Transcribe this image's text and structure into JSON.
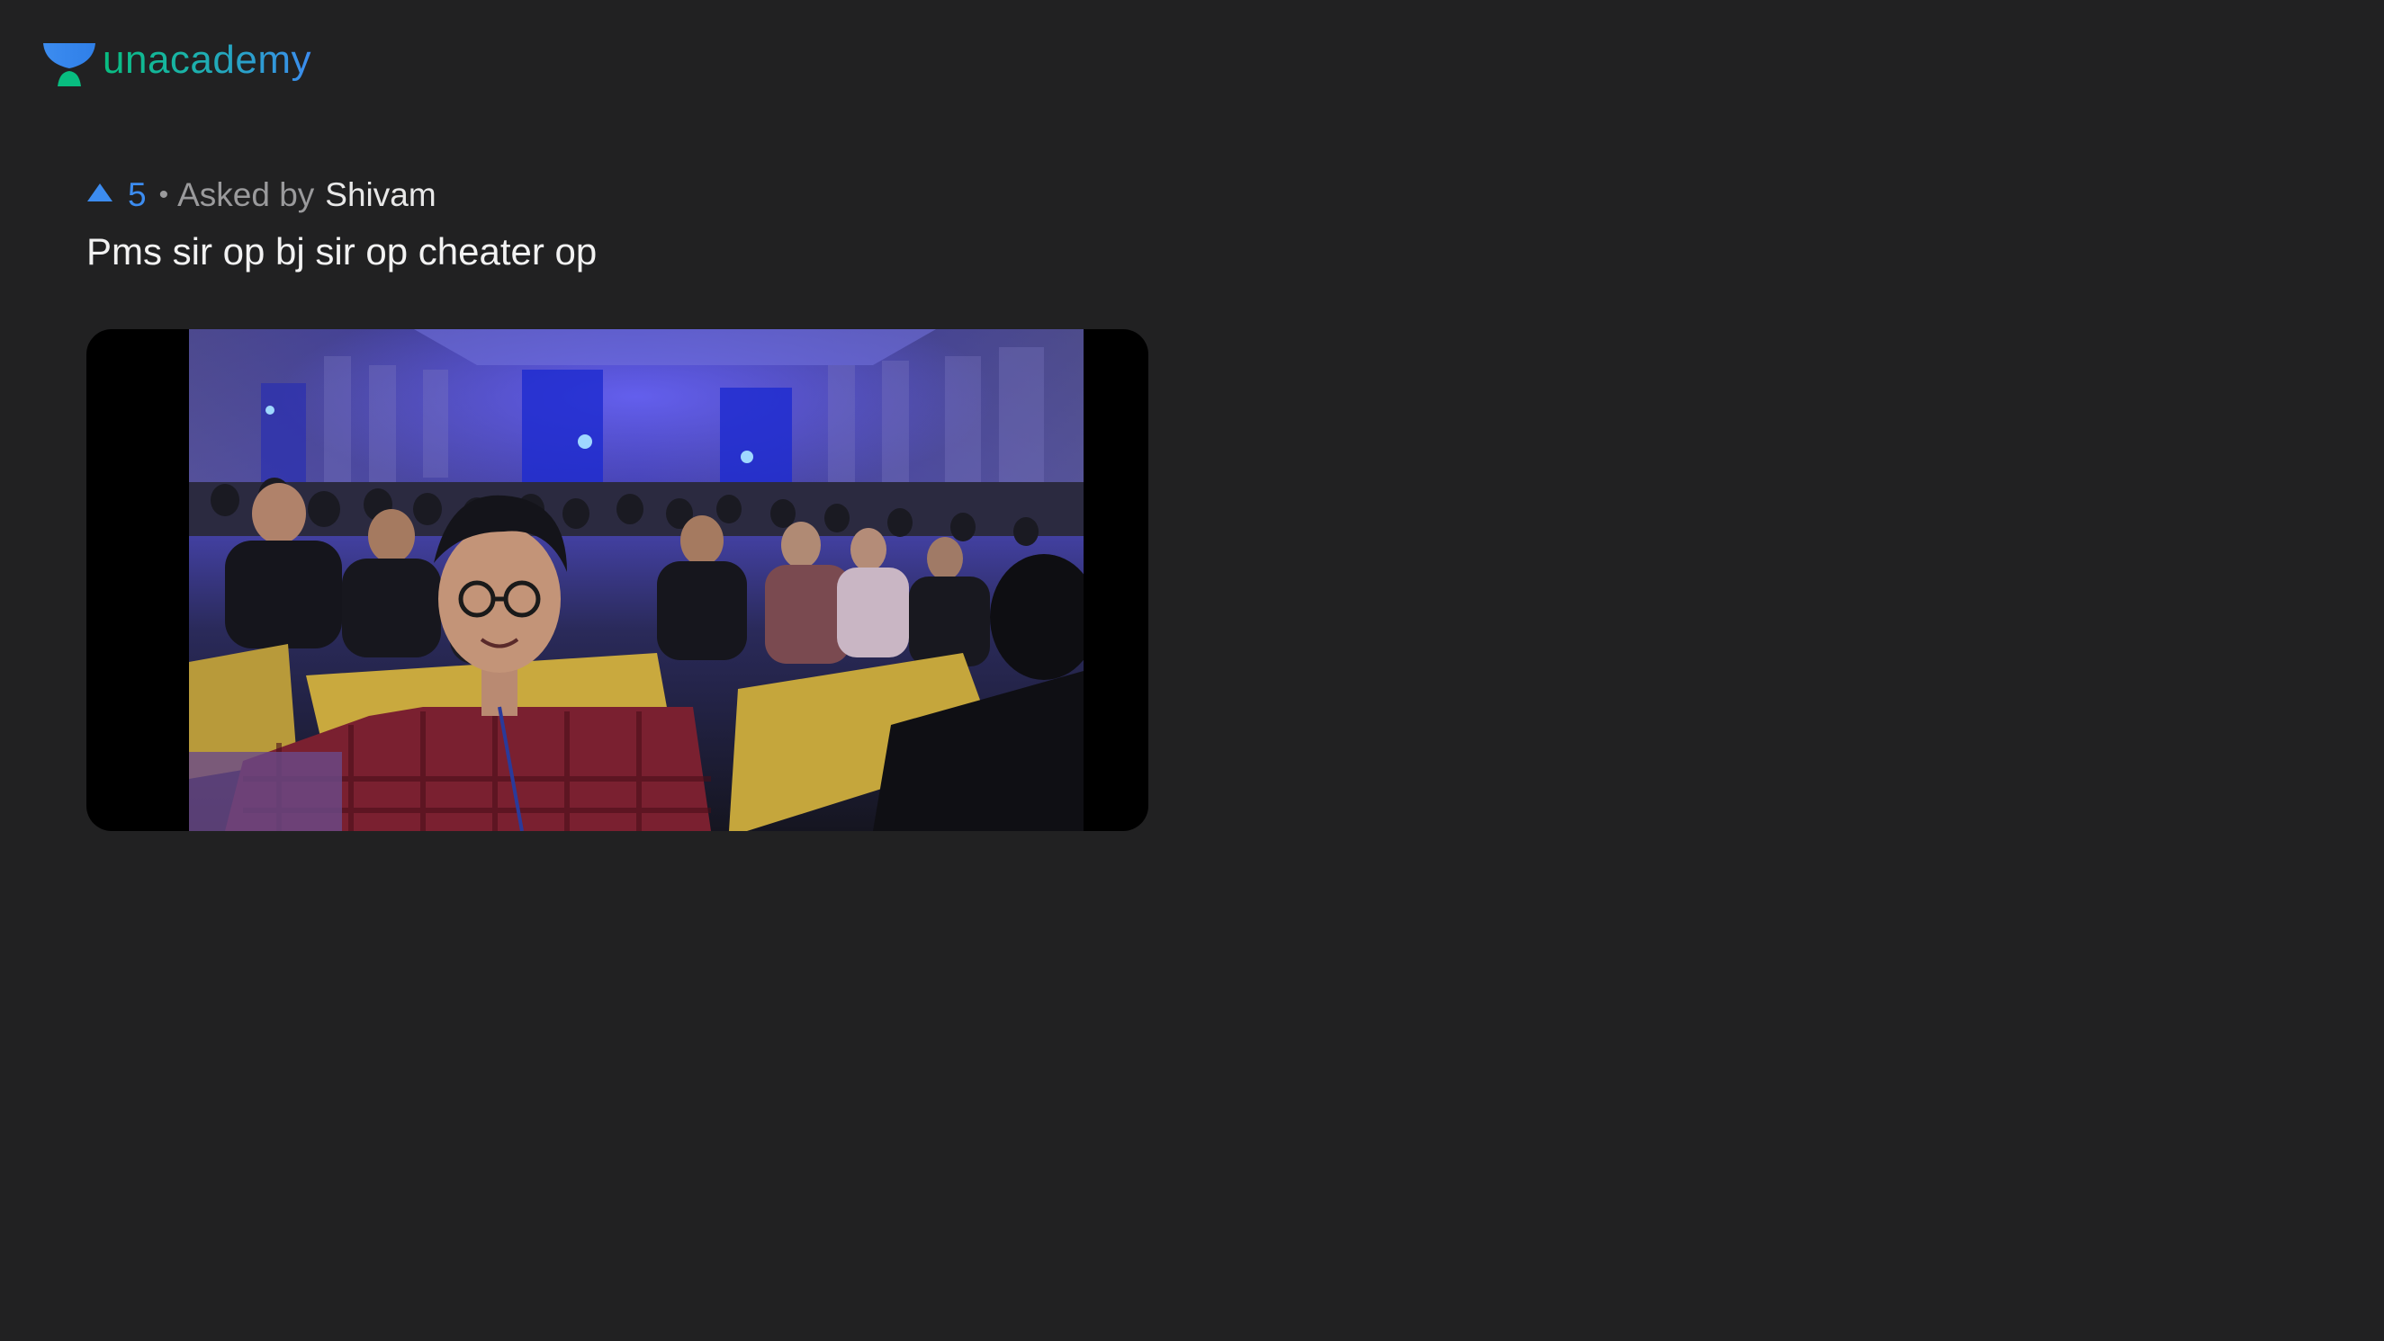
{
  "brand": {
    "name": "unacademy",
    "logo_icon": "unacademy-logo-icon",
    "colors": {
      "green": "#08bd80",
      "blue": "#3c8cf0"
    }
  },
  "question": {
    "upvote_icon": "upvote-triangle-icon",
    "upvotes": "5",
    "separator": "•",
    "asked_by_label": "Asked by",
    "author": "Shivam",
    "text": "Pms sir op bj sir op cheater op",
    "attachment": {
      "type": "photo",
      "description_icon": "photo-attachment"
    }
  },
  "theme": {
    "background": "#212122",
    "text_primary": "#f2f2f2",
    "text_muted": "#9a9a9c",
    "accent": "#3c8cf0"
  }
}
